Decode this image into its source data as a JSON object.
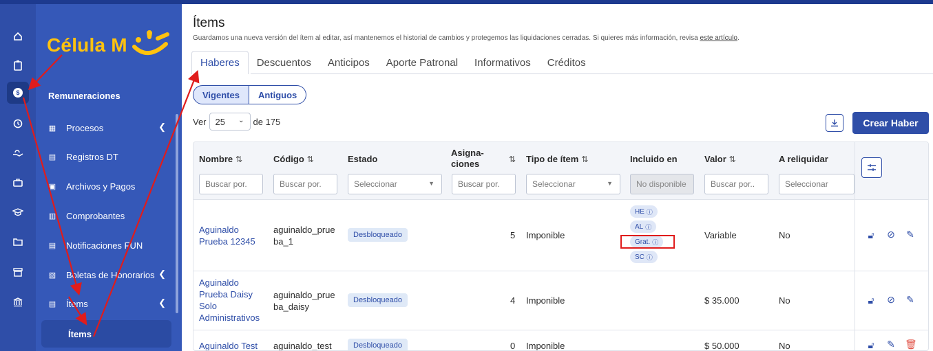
{
  "rail": {
    "icons": [
      "home-icon",
      "clipboard-icon",
      "dollar-icon",
      "clock-icon",
      "hand-icon",
      "briefcase-icon",
      "graduation-icon",
      "folder-icon",
      "store-icon",
      "bank-icon"
    ]
  },
  "nav": {
    "logo_text": "Célula M",
    "section": "Remuneraciones",
    "items": [
      {
        "label": "Procesos"
      },
      {
        "label": "Registros DT"
      },
      {
        "label": "Archivos y Pagos"
      },
      {
        "label": "Comprobantes"
      },
      {
        "label": "Notificaciones FUN"
      },
      {
        "label": "Boletas de Honorarios"
      },
      {
        "label": "Ítems"
      }
    ],
    "sub_item": "Ítems"
  },
  "page": {
    "title": "Ítems",
    "description": "Guardamos una nueva versión del ítem al editar, así mantenemos el historial de cambios y protegemos las liquidaciones cerradas. Si quieres más información, revisa ",
    "description_link": "este artículo",
    "description_end": "."
  },
  "tabs": [
    "Haberes",
    "Descuentos",
    "Anticipos",
    "Aporte Patronal",
    "Informativos",
    "Créditos"
  ],
  "segment": {
    "left": "Vigentes",
    "right": "Antiguos"
  },
  "pager": {
    "prefix": "Ver",
    "value": "25",
    "suffix": "de 175"
  },
  "create_button": "Crear Haber",
  "table": {
    "headers": {
      "nombre": "Nombre",
      "codigo": "Código",
      "estado": "Estado",
      "asignaciones": "Asigna-\nciones",
      "tipo": "Tipo de ítem",
      "incluido": "Incluido en",
      "valor": "Valor",
      "reliquidar": "A reliquidar"
    },
    "filters": {
      "nombre": "Buscar por.",
      "codigo": "Buscar por.",
      "estado": "Seleccionar",
      "asignaciones": "Buscar por.",
      "tipo": "Seleccionar",
      "incluido": "No disponible",
      "valor": "Buscar por..",
      "reliquidar": "Seleccionar"
    },
    "rows": [
      {
        "nombre": "Aguinaldo\nPrueba 12345",
        "codigo": "aguinaldo_prue\nba_1",
        "estado": "Desbloqueado",
        "asignaciones": "5",
        "tipo": "Imponible",
        "incluido": [
          "HE",
          "AL",
          "Grat.",
          "SC"
        ],
        "valor": "Variable",
        "reliquidar": "No"
      },
      {
        "nombre": "Aguinaldo\nPrueba Daisy\nSolo\nAdministrativos",
        "codigo": "aguinaldo_prue\nba_daisy",
        "estado": "Desbloqueado",
        "asignaciones": "4",
        "tipo": "Imponible",
        "incluido": [],
        "valor": "$ 35.000",
        "reliquidar": "No"
      },
      {
        "nombre": "Aguinaldo Test",
        "codigo": "aguinaldo_test",
        "estado": "Desbloqueado",
        "asignaciones": "0",
        "tipo": "Imponible",
        "incluido": [],
        "valor": "$ 50.000",
        "reliquidar": "No"
      }
    ]
  },
  "colors": {
    "rail": "#2f4ea8",
    "nav": "#3558b8",
    "accent": "#2f4ea8",
    "logo": "#ffc20e",
    "annotation": "#e01c1c"
  }
}
